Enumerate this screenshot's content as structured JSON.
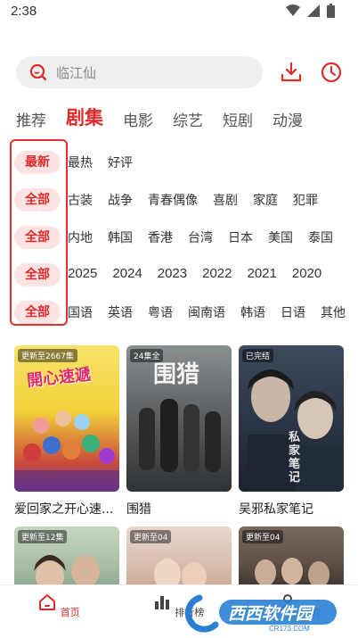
{
  "status": {
    "time": "2:38"
  },
  "search": {
    "placeholder": "临江仙"
  },
  "tabs": [
    {
      "label": "推荐",
      "active": false
    },
    {
      "label": "剧集",
      "active": true
    },
    {
      "label": "电影",
      "active": false
    },
    {
      "label": "综艺",
      "active": false
    },
    {
      "label": "短剧",
      "active": false
    },
    {
      "label": "动漫",
      "active": false
    }
  ],
  "filters": [
    {
      "selected": "最新",
      "options": [
        "最热",
        "好评"
      ]
    },
    {
      "selected": "全部",
      "options": [
        "古装",
        "战争",
        "青春偶像",
        "喜剧",
        "家庭",
        "犯罪"
      ]
    },
    {
      "selected": "全部",
      "options": [
        "内地",
        "韩国",
        "香港",
        "台湾",
        "日本",
        "美国",
        "泰国"
      ]
    },
    {
      "selected": "全部",
      "options": [
        "2025",
        "2024",
        "2023",
        "2022",
        "2021",
        "2020"
      ]
    },
    {
      "selected": "全部",
      "options": [
        "国语",
        "英语",
        "粤语",
        "闽南语",
        "韩语",
        "日语",
        "其他"
      ]
    }
  ],
  "cards": [
    {
      "badge": "更新至2667集",
      "title": "爱回家之开心速...",
      "poster_text": "開心速遞"
    },
    {
      "badge": "24集全",
      "title": "围猎",
      "poster_text": "围猎"
    },
    {
      "badge": "已完结",
      "title": "吴邪私家笔记",
      "poster_text": "私家笔记"
    }
  ],
  "cards_row2": [
    {
      "badge": "更新至12集"
    },
    {
      "badge": "更新至04"
    },
    {
      "badge": "更新至04"
    }
  ],
  "bottom_nav": [
    {
      "label": "首页",
      "active": true
    },
    {
      "label": "排行榜",
      "active": false
    },
    {
      "label": "我的",
      "active": false
    }
  ],
  "watermark": {
    "text": "西西软件园",
    "sub": "CR173.COM"
  },
  "colors": {
    "accent": "#e02b2b",
    "selected_bg": "#fde3e3"
  }
}
